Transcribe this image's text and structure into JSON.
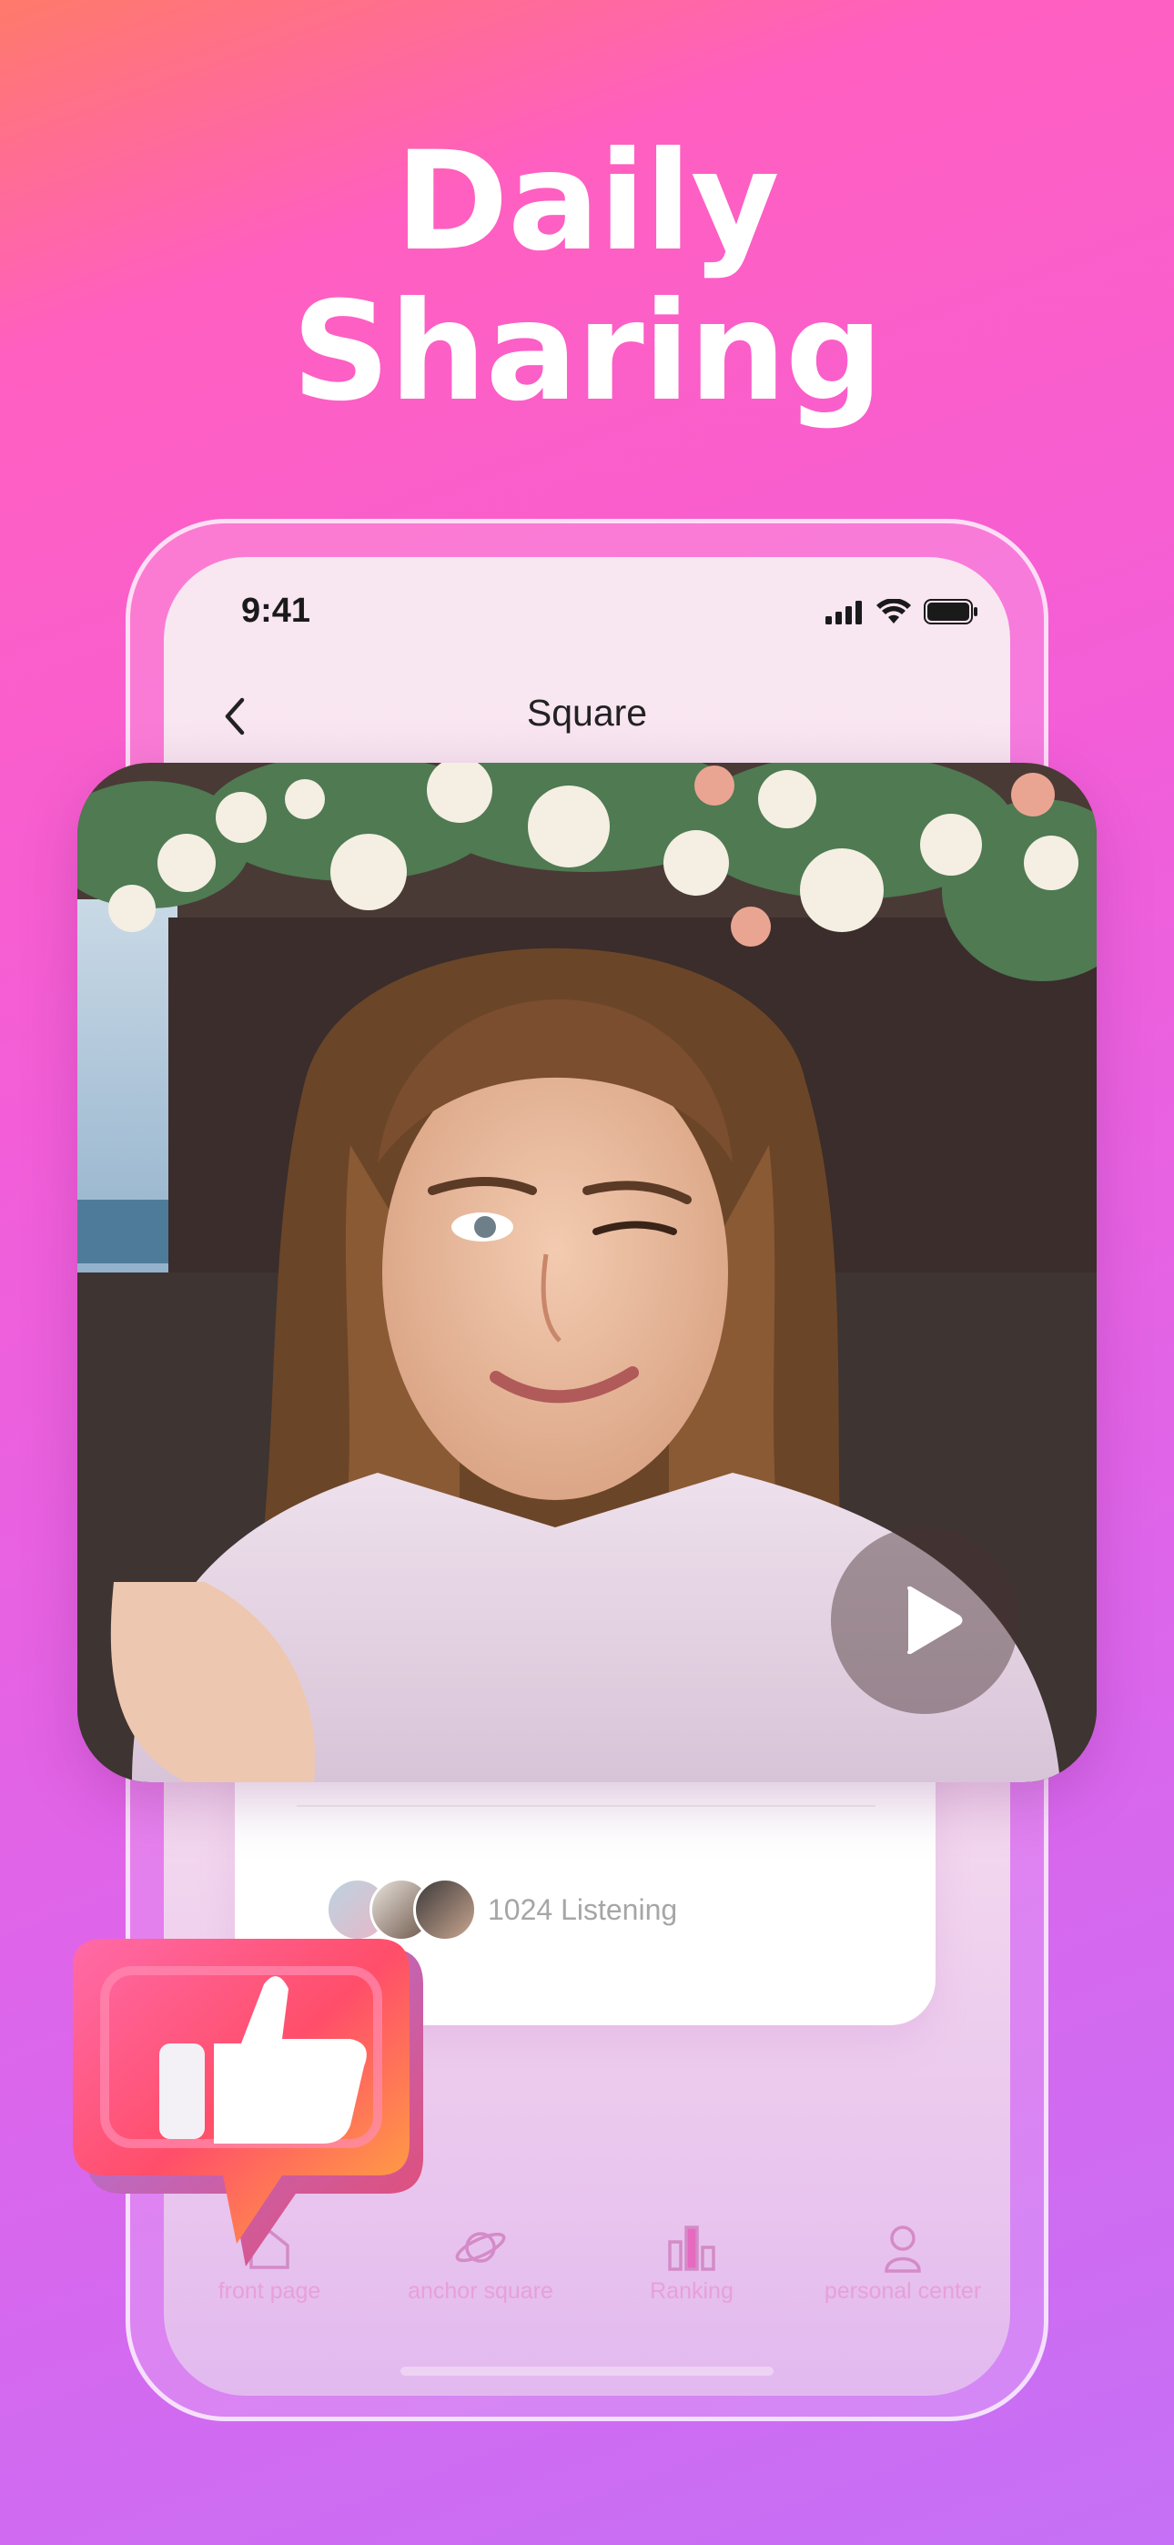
{
  "headline": {
    "line1": "Daily",
    "line2": "Sharing"
  },
  "status_bar": {
    "time": "9:41"
  },
  "nav": {
    "title": "Square"
  },
  "card": {
    "listening_count": "1024 Listening"
  },
  "tabbar": {
    "items": [
      {
        "label": "front page",
        "icon": "home-icon"
      },
      {
        "label": "anchor square",
        "icon": "planet-icon"
      },
      {
        "label": "Ranking",
        "icon": "ranking-icon"
      },
      {
        "label": "personal center",
        "icon": "person-icon"
      }
    ]
  },
  "colors": {
    "background_top": "#ff7a6a",
    "background_mid": "#f35ed8",
    "background_bottom": "#c570f6",
    "tab_label": "#e8a0d8",
    "tab_icon_accent": "#c844b0"
  },
  "icons": {
    "back": "chevron-left-icon",
    "play": "play-icon",
    "like": "thumbs-up-icon"
  }
}
